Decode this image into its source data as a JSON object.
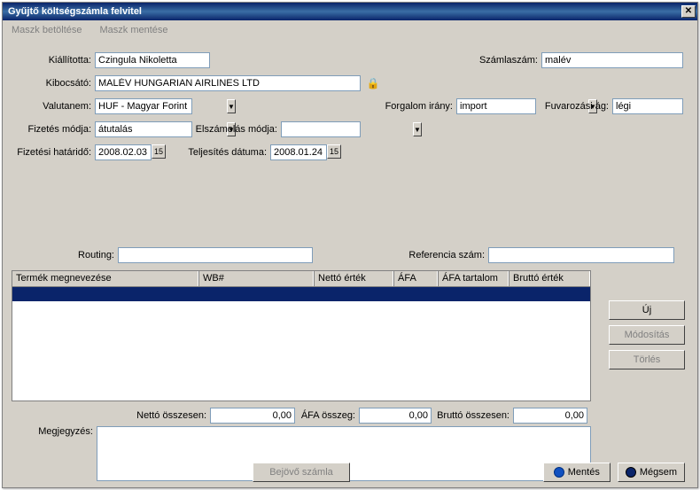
{
  "window": {
    "title": "Gyűjtő költségszámla felvitel"
  },
  "menu": {
    "load_mask": "Maszk betöltése",
    "save_mask": "Maszk mentése"
  },
  "labels": {
    "kiallitotta": "Kiállította:",
    "szamlaszam": "Számlaszám:",
    "kibocsato": "Kibocsátó:",
    "valutanem": "Valutanem:",
    "forgalom_irany": "Forgalom irány:",
    "fuvarozasi_ag": "Fuvarozási ág:",
    "fizetes_modja": "Fizetés módja:",
    "elszamolas_modja": "Elszámolás módja:",
    "fizetesi_hatarido": "Fizetési határidő:",
    "teljesites_datuma": "Teljesítés dátuma:",
    "routing": "Routing:",
    "referencia_szam": "Referencia szám:",
    "netto_osszesen": "Nettó összesen:",
    "afa_osszeg": "ÁFA összeg:",
    "brutto_osszesen": "Bruttó összesen:",
    "megjegyzes": "Megjegyzés:"
  },
  "fields": {
    "kiallitotta": "Czingula Nikoletta",
    "szamlaszam": "malév",
    "kibocsato": "MALÉV HUNGARIAN AIRLINES LTD",
    "valutanem": "HUF - Magyar Forint",
    "forgalom_irany": "import",
    "fuvarozasi_ag": "légi",
    "fizetes_modja": "átutalás",
    "elszamolas_modja": "",
    "fizetesi_hatarido": "2008.02.03",
    "teljesites_datuma": "2008.01.24",
    "routing": "",
    "referencia_szam": "",
    "netto_osszesen": "0,00",
    "afa_osszeg": "0,00",
    "brutto_osszesen": "0,00",
    "megjegyzes": ""
  },
  "grid": {
    "columns": {
      "termek": "Termék megnevezése",
      "wb": "WB#",
      "netto": "Nettó érték",
      "afa": "ÁFA",
      "afa_tartalom": "ÁFA tartalom",
      "brutto": "Bruttó érték"
    }
  },
  "buttons": {
    "uj": "Új",
    "modositas": "Módosítás",
    "torles": "Törlés",
    "bejovo_szamla": "Bejövő számla",
    "mentes": "Mentés",
    "megsem": "Mégsem"
  },
  "icons": {
    "lock": "🔒",
    "calendar": "15",
    "dropdown": "▼"
  }
}
